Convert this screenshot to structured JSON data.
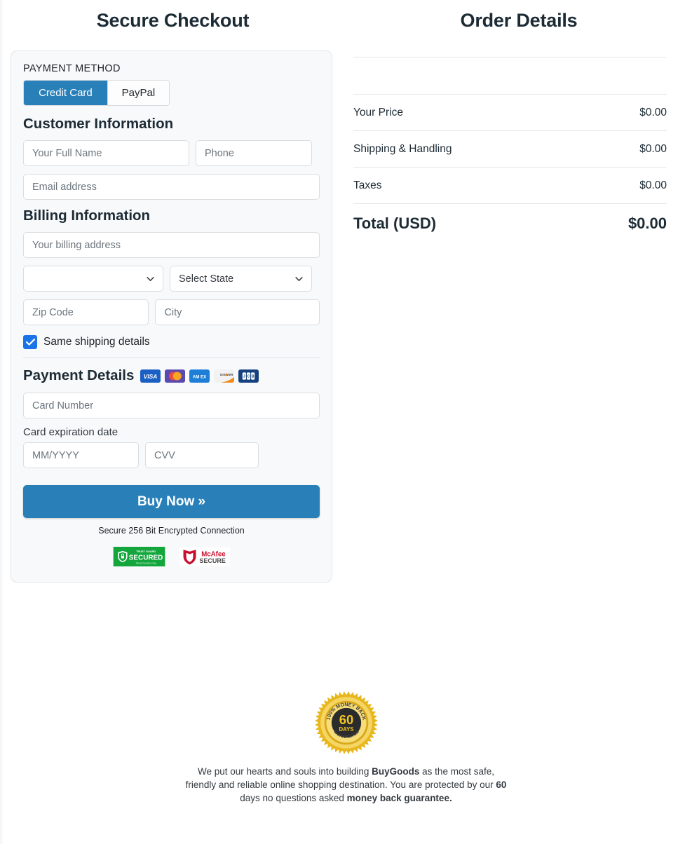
{
  "left_column": {
    "title": "Secure Checkout",
    "payment_method_label": "PAYMENT METHOD",
    "tabs": [
      {
        "label": "Credit Card",
        "active": true
      },
      {
        "label": "PayPal",
        "active": false
      }
    ],
    "customer_information": {
      "heading": "Customer Information",
      "full_name_placeholder": "Your Full Name",
      "phone_placeholder": "Phone",
      "email_placeholder": "Email address"
    },
    "billing_information": {
      "heading": "Billing Information",
      "address_placeholder": "Your billing address",
      "country_value": "",
      "state_value": "Select State",
      "zip_placeholder": "Zip Code",
      "city_placeholder": "City"
    },
    "same_shipping": {
      "label": "Same shipping details",
      "checked": true
    },
    "payment_details": {
      "heading": "Payment Details",
      "card_brands": [
        "visa-logo",
        "mastercard-logo",
        "amex-logo",
        "discover-logo",
        "jcb-logo"
      ],
      "card_number_placeholder": "Card Number",
      "expiration_label": "Card expiration date",
      "expiration_placeholder": "MM/YYYY",
      "cvv_placeholder": "CVV"
    },
    "buy_button_label": "Buy Now »",
    "secure_note": "Secure 256 Bit Encrypted Connection",
    "trust_badges": [
      {
        "icon": "trust-guard-secured-badge",
        "line1": "TRUST GUARD",
        "line2": "SECURED",
        "line3": "TRUSTGUARD.COM"
      },
      {
        "icon": "mcafee-secure-badge",
        "line1": "McAfee",
        "line2": "SECURE"
      }
    ]
  },
  "right_column": {
    "title": "Order Details",
    "rows": [
      {
        "label": "Your Price",
        "value": "$0.00"
      },
      {
        "label": "Shipping & Handling",
        "value": "$0.00"
      },
      {
        "label": "Taxes",
        "value": "$0.00"
      }
    ],
    "total": {
      "label": "Total (USD)",
      "value": "$0.00"
    }
  },
  "footer": {
    "seal": {
      "icon": "money-back-guarantee-seal",
      "top_text": "100% MONEY BACK",
      "number": "60",
      "unit": "DAYS",
      "bottom_text": "GUARANTEE"
    },
    "text_part1": "We put our hearts and souls into building ",
    "brand": "BuyGoods",
    "text_part2": " as the most safe, friendly and reliable online shopping destination. You are protected by our ",
    "days": "60",
    "text_part3": " days no questions asked ",
    "guarantee": "money back guarantee."
  },
  "colors": {
    "accent_blue": "#2980b9",
    "checkbox_blue": "#1a73e8",
    "card_bg": "#f8f9fa",
    "border": "#e3e6ea"
  }
}
